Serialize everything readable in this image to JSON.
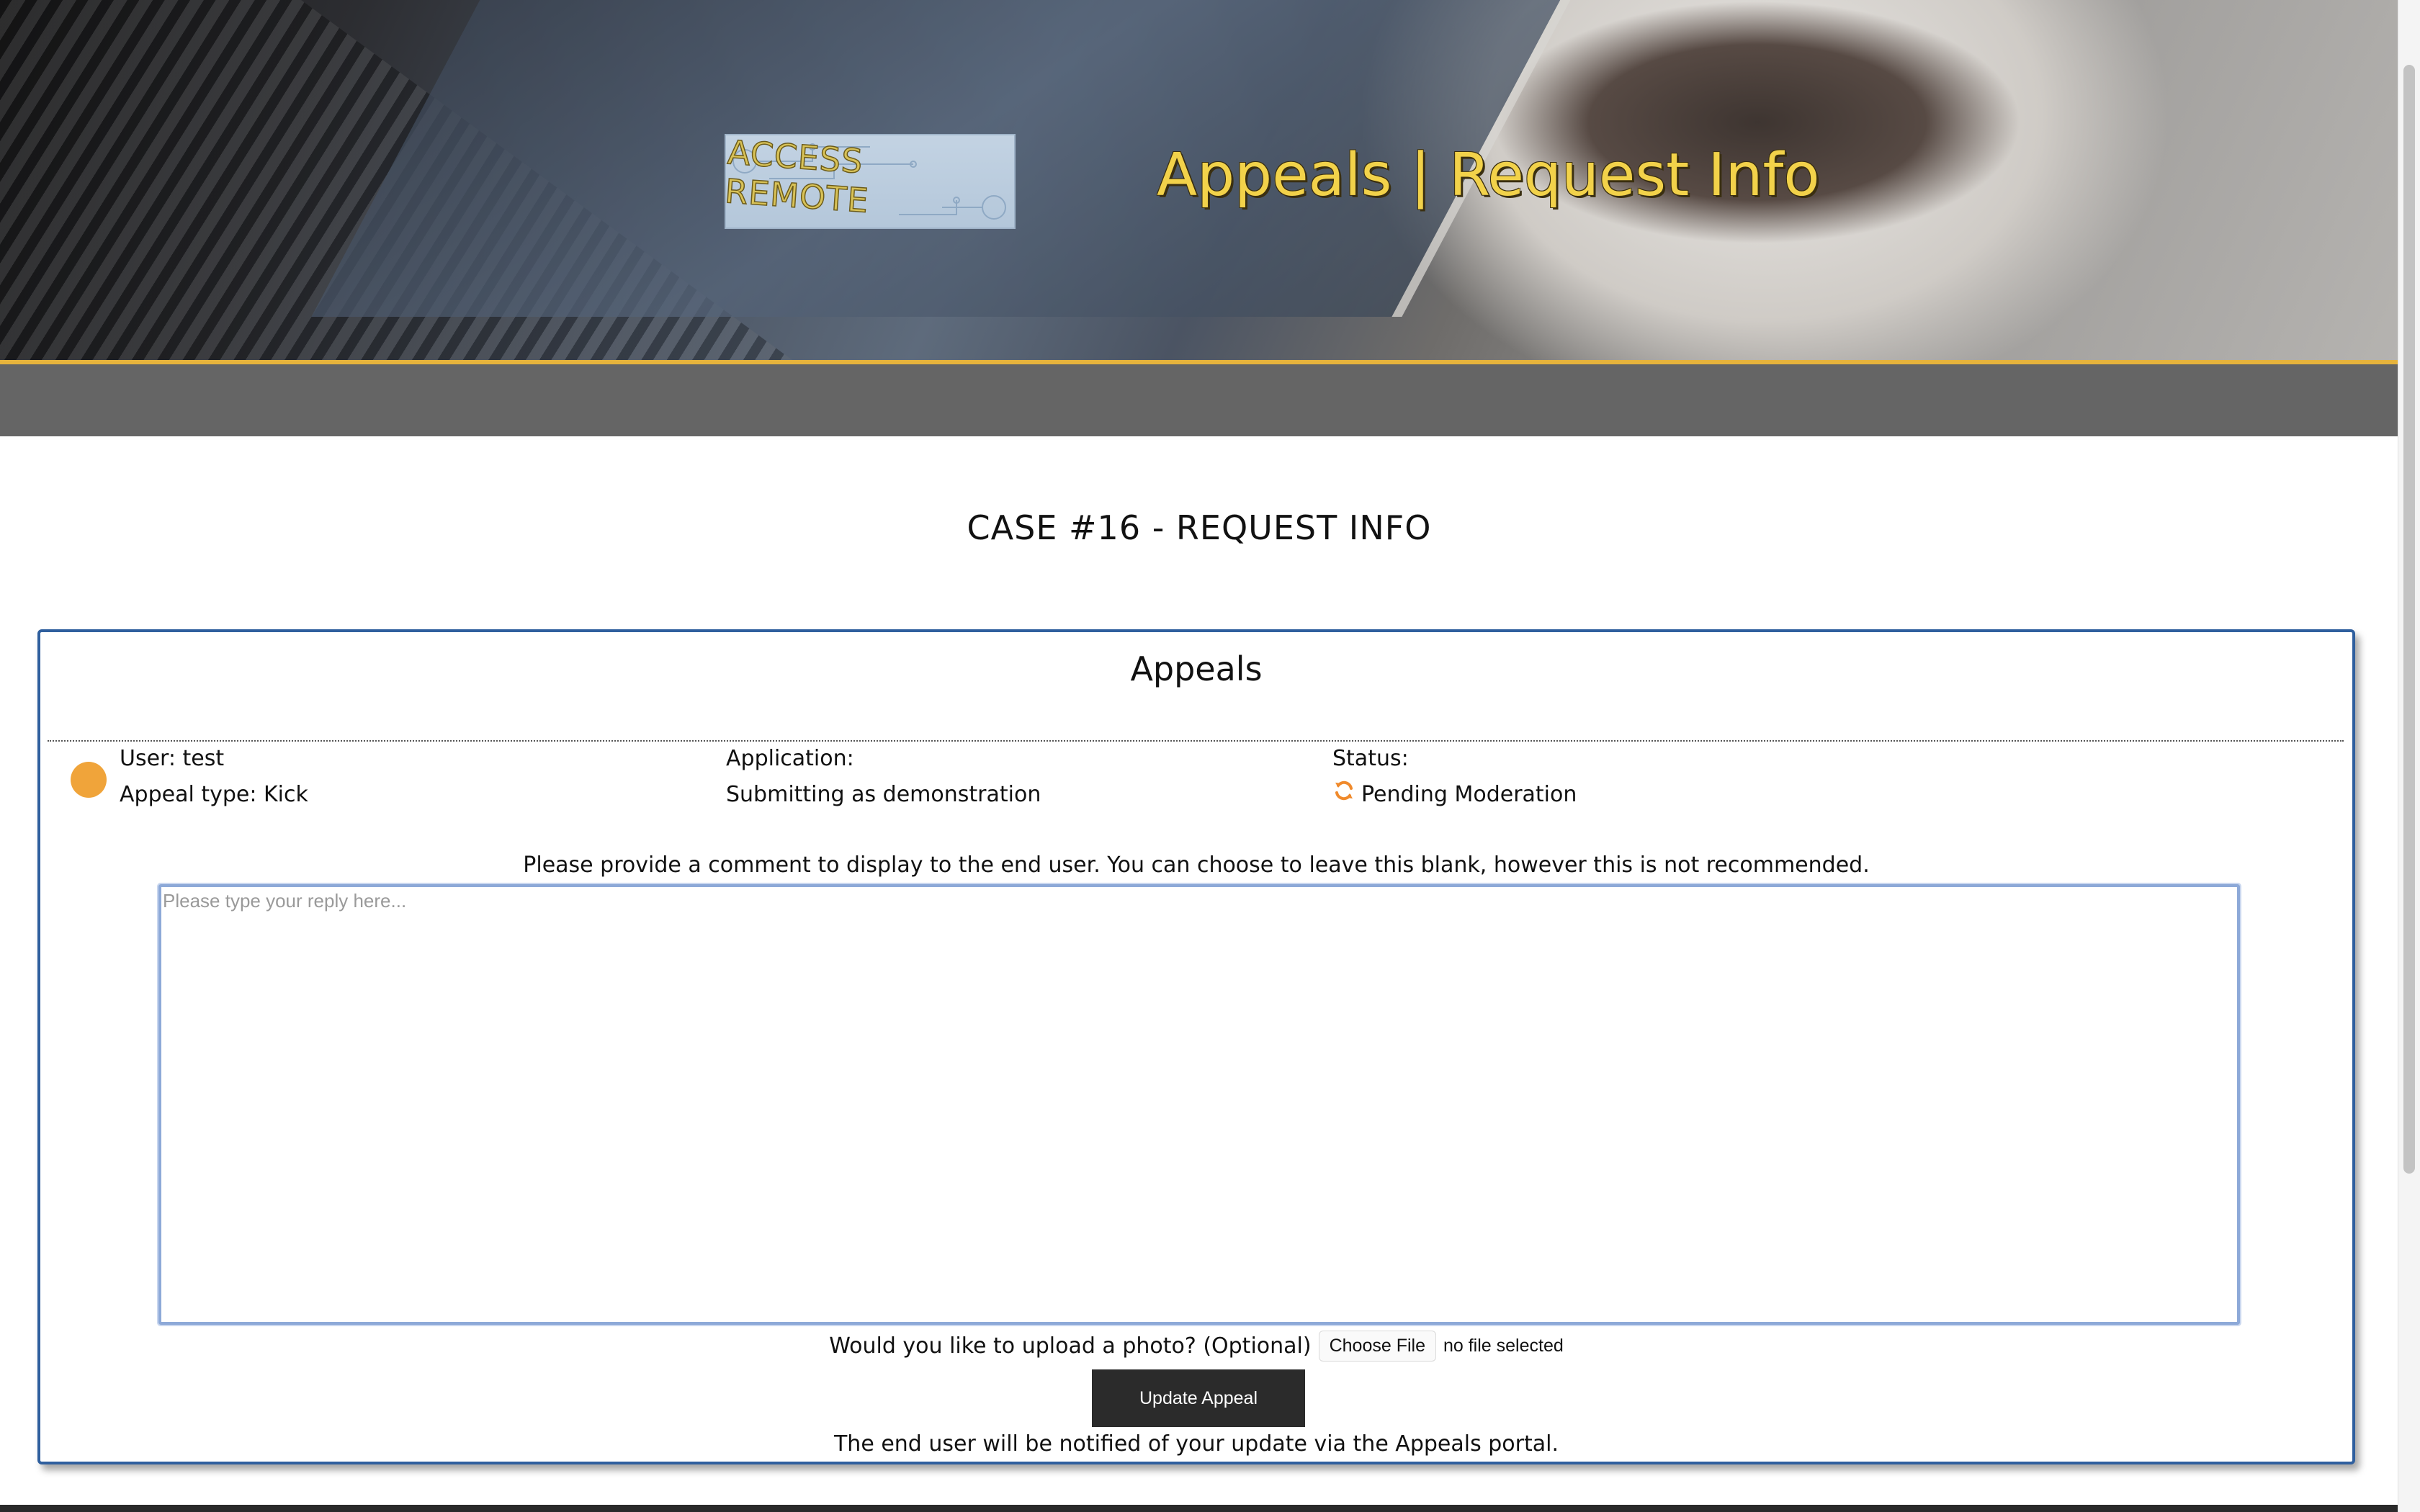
{
  "header": {
    "logo_text": "ACCESS REMOTE",
    "title": "Appeals | Request Info"
  },
  "page": {
    "title": "CASE #16 - REQUEST INFO"
  },
  "panel": {
    "title": "Appeals",
    "status_dot_color": "#f0a43a",
    "user_label": "User: test",
    "appeal_type_label": "Appeal type: Kick",
    "application_label": "Application:",
    "application_value": "Submitting as demonstration",
    "status_label": "Status:",
    "status_icon": "refresh-icon",
    "status_value": "Pending Moderation",
    "instruction": "Please provide a comment to display to the end user. You can choose to leave this blank, however this is not recommended.",
    "reply_placeholder": "Please type your reply here...",
    "reply_value": "",
    "upload_label": "Would you like to upload a photo? (Optional)",
    "choose_file_label": "Choose File",
    "no_file_label": "no file selected",
    "update_button_label": "Update Appeal",
    "footnote": "The end user will be notified of your update via the Appeals portal."
  },
  "colors": {
    "accent_gold": "#e6b33c",
    "panel_border": "#2f5f9e",
    "nav_bar": "#656565",
    "button_dark": "#2b2b2b"
  }
}
